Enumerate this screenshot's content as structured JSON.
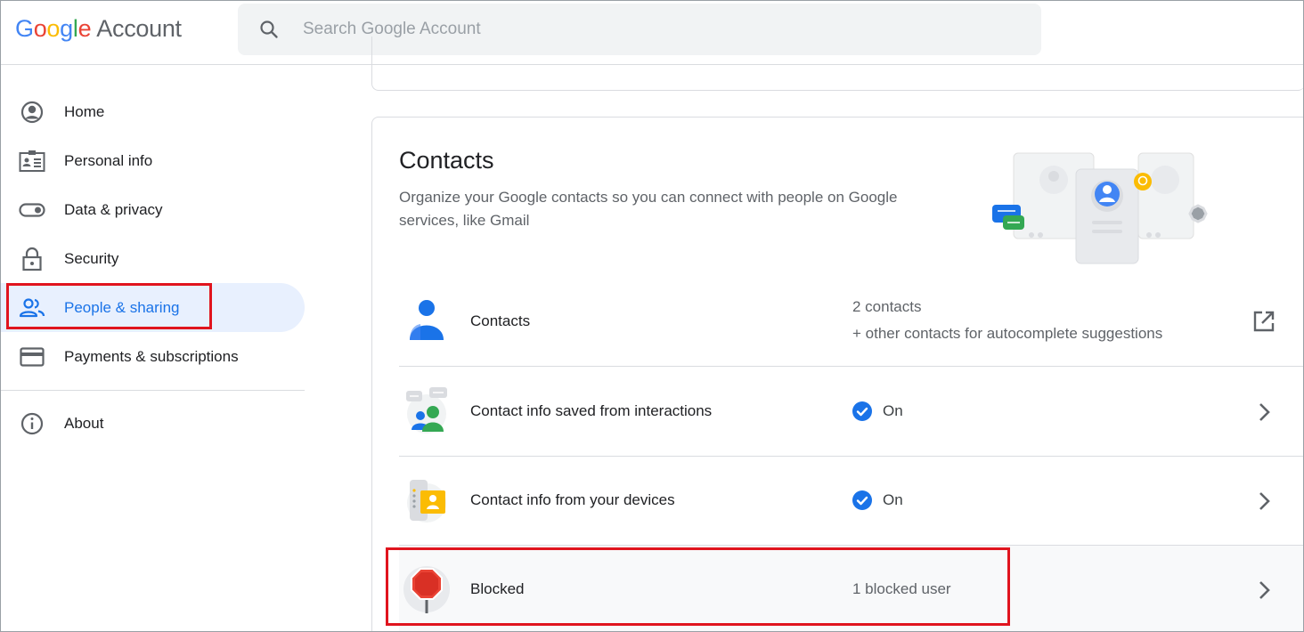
{
  "header": {
    "logo_letters": [
      "G",
      "o",
      "o",
      "g",
      "l",
      "e"
    ],
    "logo_account": "Account",
    "search_placeholder": "Search Google Account"
  },
  "sidebar": {
    "items": [
      {
        "label": "Home",
        "icon": "account-circle-icon"
      },
      {
        "label": "Personal info",
        "icon": "id-card-icon"
      },
      {
        "label": "Data & privacy",
        "icon": "toggle-icon"
      },
      {
        "label": "Security",
        "icon": "lock-icon"
      },
      {
        "label": "People & sharing",
        "icon": "people-icon",
        "active": true
      },
      {
        "label": "Payments & subscriptions",
        "icon": "credit-card-icon"
      },
      {
        "label": "About",
        "icon": "info-icon"
      }
    ]
  },
  "card": {
    "title": "Contacts",
    "description": "Organize your Google contacts so you can connect with people on Google services, like Gmail",
    "rows": [
      {
        "label": "Contacts",
        "value_line1": "2 contacts",
        "value_line2": "+ other contacts for autocomplete suggestions",
        "action_icon": "open-in-new-icon"
      },
      {
        "label": "Contact info saved from interactions",
        "status": "On",
        "action_icon": "chevron-right-icon"
      },
      {
        "label": "Contact info from your devices",
        "status": "On",
        "action_icon": "chevron-right-icon"
      },
      {
        "label": "Blocked",
        "value": "1 blocked user",
        "action_icon": "chevron-right-icon"
      }
    ]
  },
  "colors": {
    "accent_blue": "#1a73e8",
    "active_bg": "#e8f0fe",
    "highlight_red": "#e0141e",
    "check_blue": "#1a73e8"
  }
}
